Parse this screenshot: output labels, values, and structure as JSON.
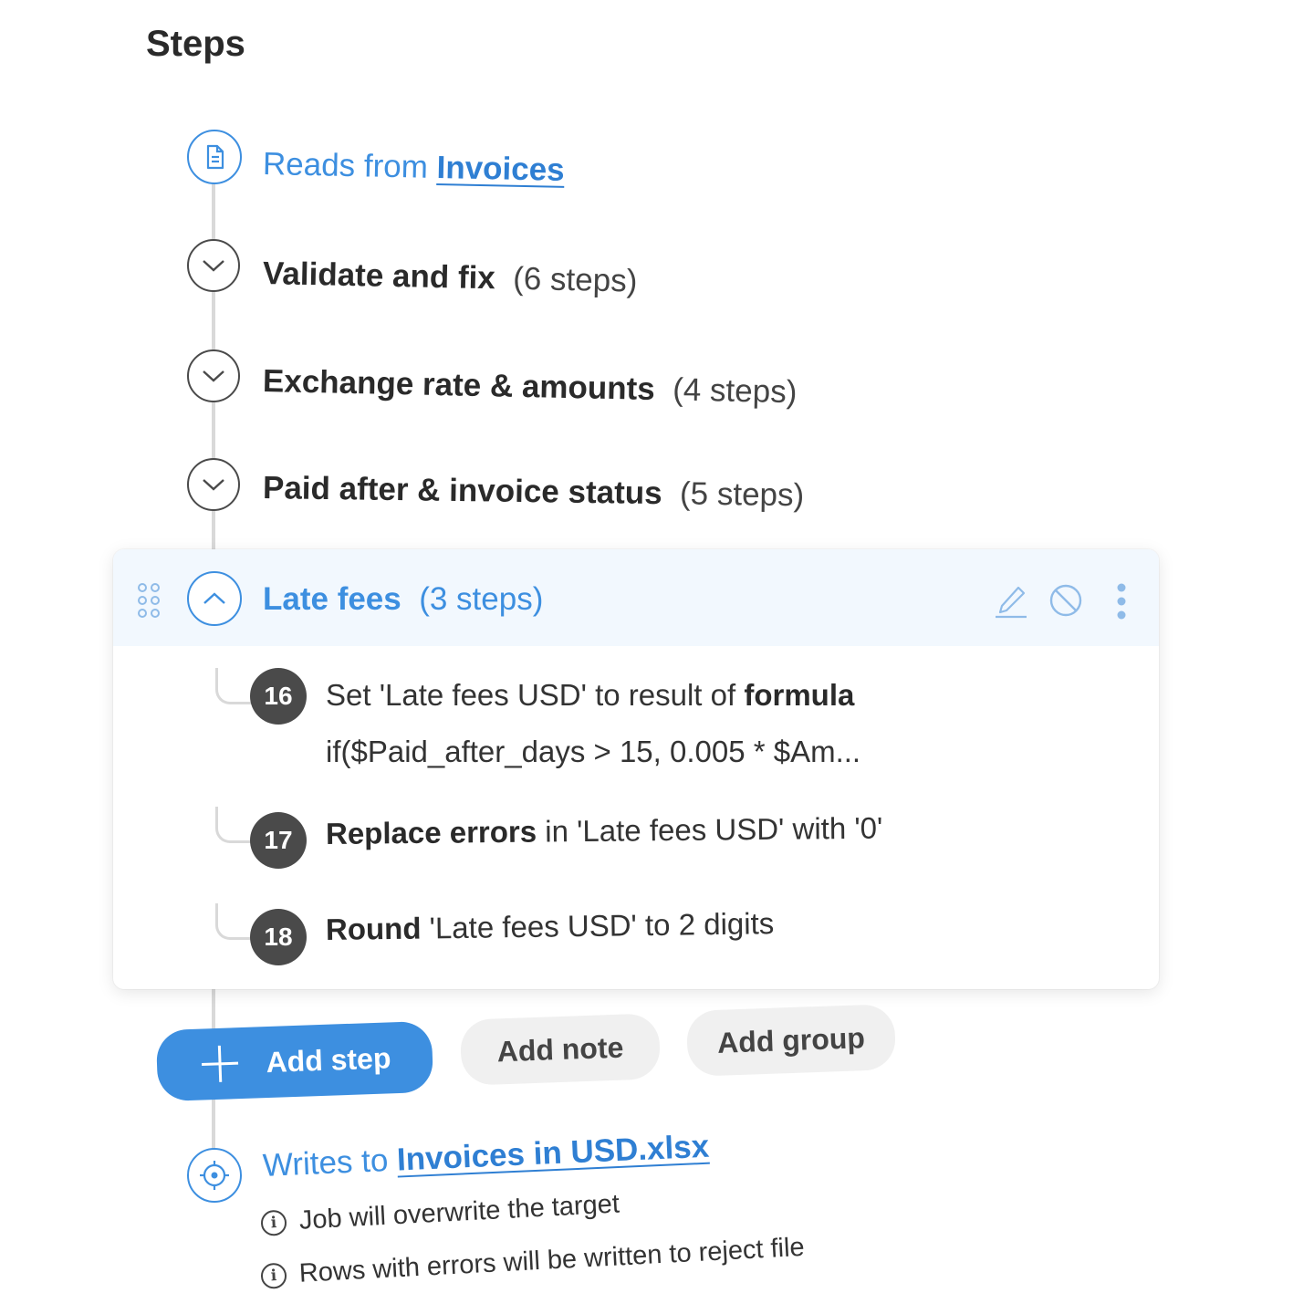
{
  "header": {
    "title": "Steps"
  },
  "source": {
    "prefix": "Reads from ",
    "link": "Invoices",
    "icon": "document-icon"
  },
  "groups": [
    {
      "label": "Validate and fix",
      "count": "(6 steps)",
      "icon": "chevron-down-icon"
    },
    {
      "label": "Exchange rate & amounts",
      "count": "(4 steps)",
      "icon": "chevron-down-icon"
    },
    {
      "label": "Paid after & invoice status",
      "count": "(5 steps)",
      "icon": "chevron-down-icon"
    }
  ],
  "expanded_group": {
    "label": "Late fees",
    "count": "(3 steps)",
    "icon": "chevron-up-icon",
    "actions": [
      "drag-handle-icon",
      "edit-icon",
      "disable-icon",
      "more-icon"
    ],
    "steps": [
      {
        "number": "16",
        "pre": "Set 'Late fees USD' to result of ",
        "bold": "formula",
        "post": "",
        "detail": "if($Paid_after_days > 15, 0.005 * $Am..."
      },
      {
        "number": "17",
        "pre": "",
        "bold": "Replace errors",
        "post": " in 'Late fees USD' with '0'"
      },
      {
        "number": "18",
        "pre": "",
        "bold": "Round",
        "post": " 'Late fees USD' to 2 digits"
      }
    ]
  },
  "buttons": {
    "add_step": "Add step",
    "add_note": "Add note",
    "add_group": "Add group"
  },
  "target": {
    "prefix": "Writes to ",
    "link": "Invoices in USD.xlsx",
    "icon": "target-icon",
    "notes": [
      "Job will overwrite the target",
      "Rows with errors will be written to reject file"
    ]
  },
  "colors": {
    "accent": "#3d8fe0",
    "badge": "#4a4a4a",
    "rail": "#d9d9d9",
    "card_header": "#f2f8fe"
  }
}
